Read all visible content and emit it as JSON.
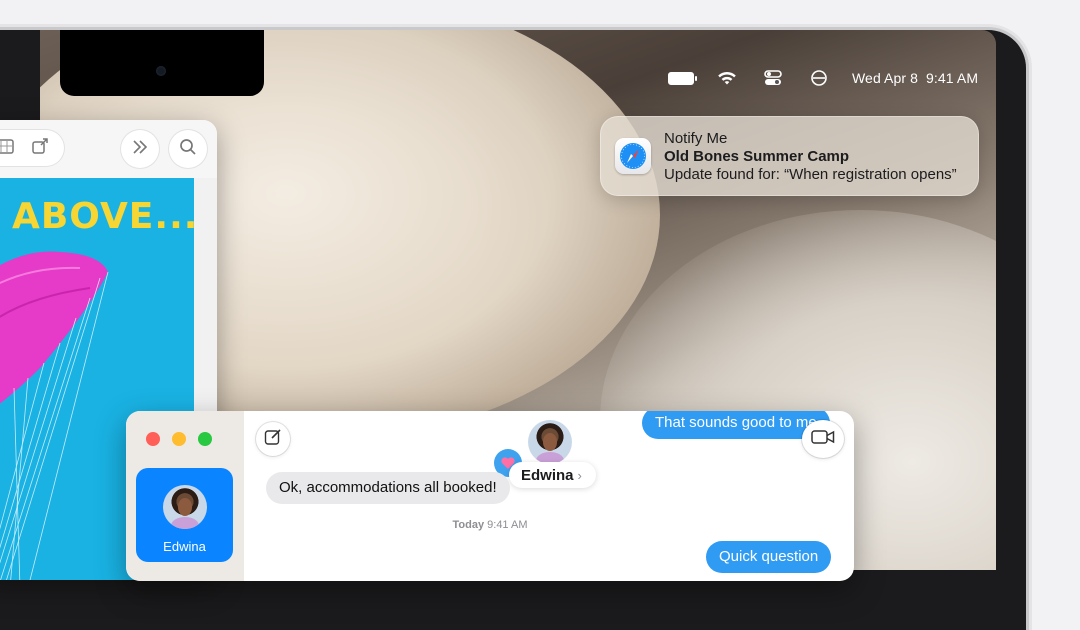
{
  "menubar": {
    "date": "Wed Apr 8",
    "time": "9:41 AM",
    "icons": [
      "battery-icon",
      "wifi-icon",
      "control-center-icon",
      "focus-icon"
    ]
  },
  "notification": {
    "app": "Safari",
    "title": "Notify Me",
    "subtitle": "Old Bones Summer Camp",
    "body": "Update found for: “When registration opens”"
  },
  "browser": {
    "headline": "ABOVE..."
  },
  "messages": {
    "conversation": {
      "name": "Edwina"
    },
    "contact_name": "Edwina",
    "chevron": "›",
    "bubbles": {
      "top_outgoing": "That sounds good to me",
      "incoming": "Ok, accommodations all booked!",
      "bottom_outgoing": "Quick question"
    },
    "timestamp_day": "Today",
    "timestamp_time": "9:41 AM"
  },
  "colors": {
    "accent": "#0a84ff",
    "bubble_out": "#2f9bf3",
    "bubble_in": "#e9e9eb",
    "page_bg": "#19b2e3",
    "headline": "#f7d533"
  }
}
